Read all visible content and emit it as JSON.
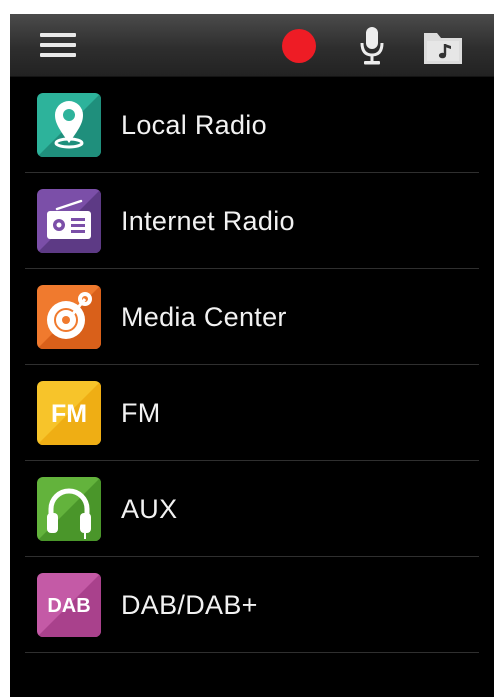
{
  "toolbar": {
    "menu_icon": "hamburger-menu-icon",
    "record_icon": "record-icon",
    "mic_icon": "microphone-icon",
    "folder_icon": "music-folder-icon",
    "record_color": "#ee1c25"
  },
  "menu": {
    "items": [
      {
        "label": "Local Radio",
        "icon": "location-pin-icon",
        "color": "#2db39b"
      },
      {
        "label": "Internet Radio",
        "icon": "radio-icon",
        "color": "#7b4fa8"
      },
      {
        "label": "Media Center",
        "icon": "disc-icon",
        "color": "#f07a2e"
      },
      {
        "label": "FM",
        "icon_text": "FM",
        "icon": "fm-icon",
        "color": "#f7c42a"
      },
      {
        "label": "AUX",
        "icon": "headphones-icon",
        "color": "#63b33c"
      },
      {
        "label": "DAB/DAB+",
        "icon_text": "DAB",
        "icon": "dab-icon",
        "color": "#c45aa6"
      }
    ]
  }
}
